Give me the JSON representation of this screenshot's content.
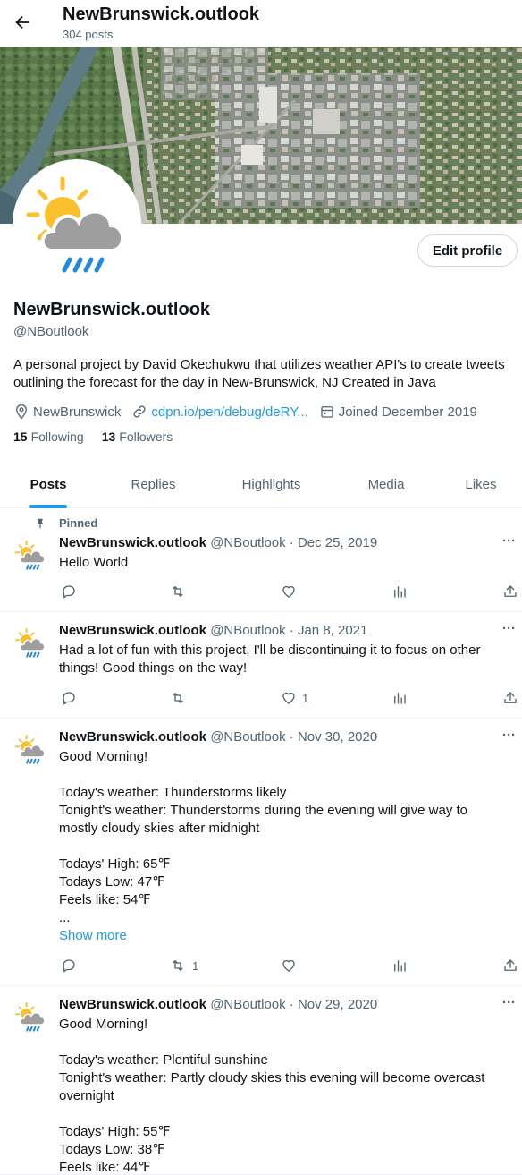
{
  "header": {
    "title": "NewBrunswick.outlook",
    "post_count": "304 posts"
  },
  "profile": {
    "display_name": "NewBrunswick.outlook",
    "handle": "@NBoutlook",
    "bio": "A personal project by David Okechukwu that utilizes weather API's to create tweets outlining the forecast for the day in New-Brunswick, NJ Created in Java",
    "location": "NewBrunswick",
    "website": "cdpn.io/pen/debug/deRY...",
    "joined": "Joined December 2019",
    "following_count": "15",
    "following_label": "Following",
    "followers_count": "13",
    "followers_label": "Followers",
    "edit_button": "Edit profile"
  },
  "tabs": [
    "Posts",
    "Replies",
    "Highlights",
    "Media",
    "Likes"
  ],
  "pinned_label": "Pinned",
  "tweets": [
    {
      "name": "NewBrunswick.outlook",
      "meta": "@NBoutlook · Dec 25, 2019",
      "lines": [
        "Hello World"
      ],
      "retweets": "",
      "likes": ""
    },
    {
      "name": "NewBrunswick.outlook",
      "meta": "@NBoutlook · Jan 8, 2021",
      "lines": [
        "Had a lot of fun with this project, I'll be discontinuing it to focus on other",
        "things! Good things on the way!"
      ],
      "retweets": "",
      "likes": "1"
    },
    {
      "name": "NewBrunswick.outlook",
      "meta": "@NBoutlook · Nov 30, 2020",
      "lines": [
        "Good Morning!",
        "",
        "Today's weather: Thunderstorms likely",
        "Tonight's weather: Thunderstorms during the evening will give way to",
        "mostly cloudy skies after midnight",
        "",
        "Todays' High: 65℉",
        "Todays Low: 47℉",
        "Feels like: 54℉",
        "..."
      ],
      "show_more": "Show more",
      "retweets": "1",
      "likes": ""
    },
    {
      "name": "NewBrunswick.outlook",
      "meta": "@NBoutlook · Nov 29, 2020",
      "lines": [
        "Good Morning!",
        "",
        "Today's weather: Plentiful sunshine",
        "Tonight's weather: Partly cloudy skies this evening will become overcast",
        "overnight",
        "",
        "Todays' High: 55℉",
        "Todays Low: 38℉",
        "Feels like: 44℉"
      ],
      "retweets": "",
      "likes": ""
    }
  ],
  "more_icon": "···",
  "colors": {
    "accent": "#1d9bf0",
    "muted": "#536471",
    "text": "#0f1419",
    "sun": "#fbc02d",
    "cloud": "#9e9e9e",
    "rain": "#1e88e5"
  }
}
